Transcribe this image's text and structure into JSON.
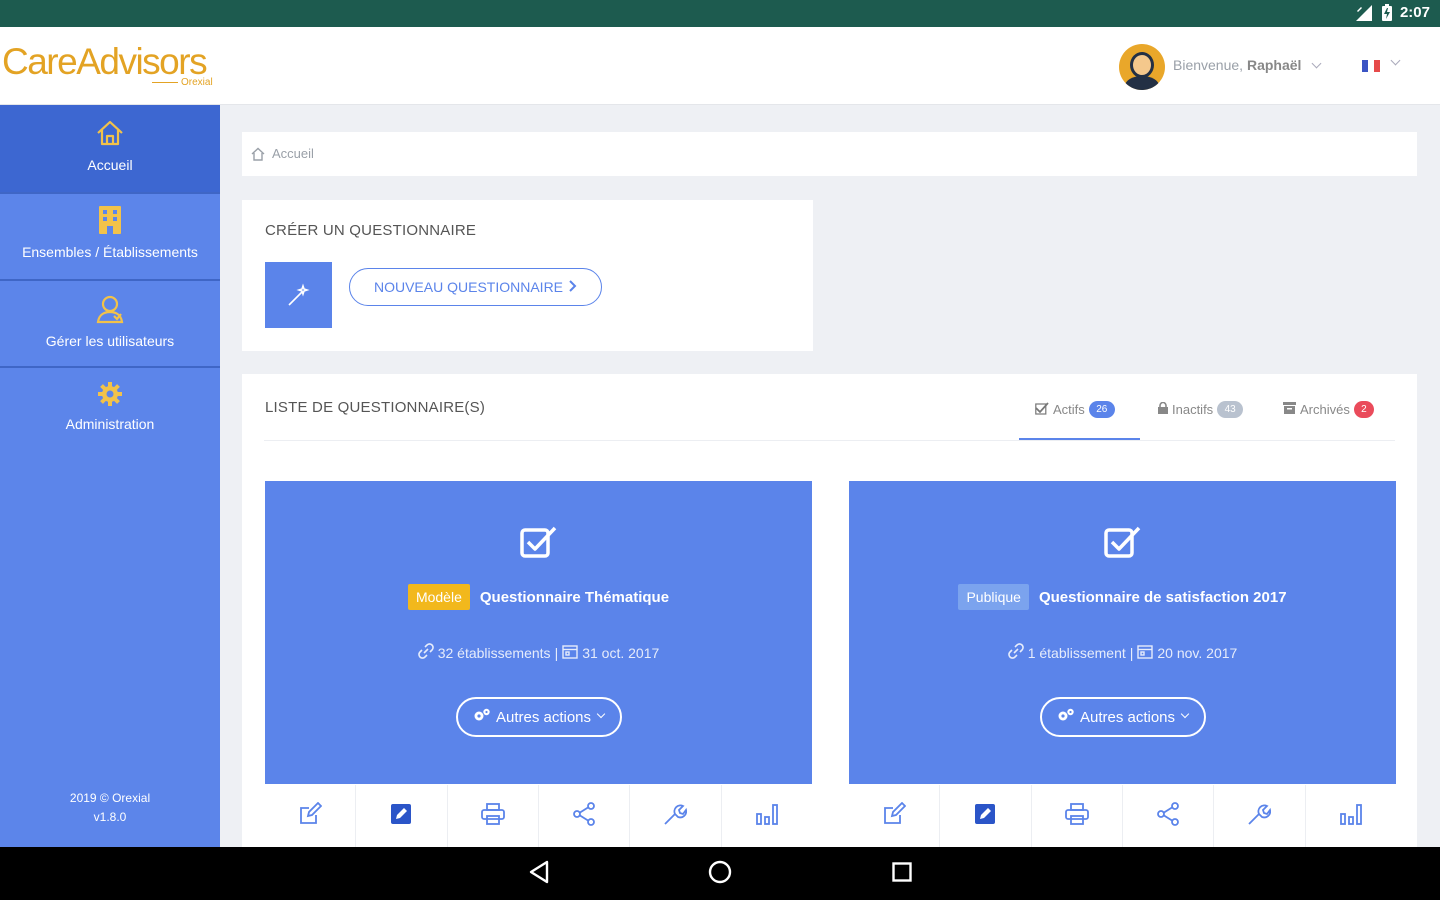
{
  "status_bar": {
    "time": "2:07"
  },
  "header": {
    "logo": "CareAdvisors",
    "logo_sub": "Orexial",
    "welcome_prefix": "Bienvenue,",
    "user_name": "Raphaël",
    "flag_colors": [
      "#3b54c4",
      "#ffffff",
      "#e64a4a"
    ]
  },
  "sidebar": {
    "items": [
      {
        "label": "Accueil",
        "icon": "home-icon"
      },
      {
        "label": "Ensembles / Établissements",
        "icon": "building-icon"
      },
      {
        "label": "Gérer les utilisateurs",
        "icon": "users-icon"
      },
      {
        "label": "Administration",
        "icon": "gear-icon"
      }
    ],
    "footer_line1": "2019 © Orexial",
    "footer_line2": "v1.8.0"
  },
  "breadcrumb": {
    "label": "Accueil"
  },
  "create_section": {
    "title": "CRÉER UN QUESTIONNAIRE",
    "button_label": "NOUVEAU QUESTIONNAIRE"
  },
  "list_section": {
    "title": "LISTE DE QUESTIONNAIRE(S)",
    "tabs": [
      {
        "label": "Actifs",
        "count": "26",
        "color": "#5b84ea"
      },
      {
        "label": "Inactifs",
        "count": "43",
        "color": "#b9c2cf"
      },
      {
        "label": "Archivés",
        "count": "2",
        "color": "#ea4b5b"
      }
    ],
    "cards": [
      {
        "badge": "Modèle",
        "badge_color": "#f2b81c",
        "title": "Questionnaire Thématique",
        "establishments": "32 établissements",
        "date": "31 oct. 2017",
        "actions_label": "Autres actions"
      },
      {
        "badge": "Publique",
        "badge_color": "#7ba3ee",
        "title": "Questionnaire de satisfaction 2017",
        "establishments": "1 établissement",
        "date": "20 nov. 2017",
        "actions_label": "Autres actions"
      }
    ],
    "toolbar_icons": [
      "edit-icon",
      "edit-filled-icon",
      "print-icon",
      "share-icon",
      "wrench-icon",
      "bar-chart-icon"
    ]
  }
}
